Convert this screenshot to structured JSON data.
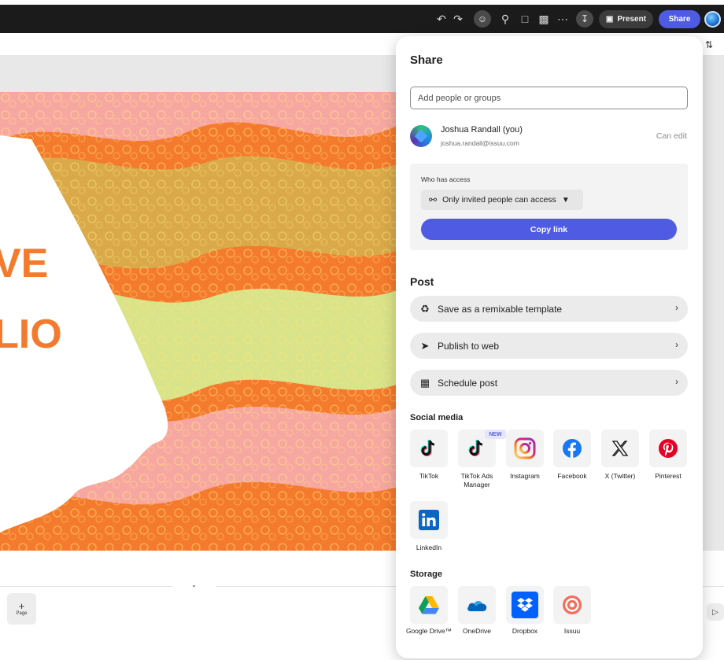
{
  "topbar": {
    "present_label": "Present",
    "share_label": "Share"
  },
  "canvas": {
    "text_line1": "VE",
    "text_line2": "LIO",
    "add_page_plus": "+",
    "add_page_label": "Page"
  },
  "share_panel": {
    "title": "Share",
    "add_people_placeholder": "Add people or groups",
    "user": {
      "name": "Joshua Randall (you)",
      "email": "joshua.randall@issuu.com",
      "permission": "Can edit"
    },
    "access": {
      "label": "Who has access",
      "selected": "Only invited people can access",
      "copy_link_label": "Copy link"
    },
    "post": {
      "title": "Post",
      "items": [
        {
          "label": "Save as a remixable template",
          "icon": "remix-icon"
        },
        {
          "label": "Publish to web",
          "icon": "send-icon"
        },
        {
          "label": "Schedule post",
          "icon": "calendar-icon"
        }
      ]
    },
    "social": {
      "title": "Social media",
      "new_badge": "NEW",
      "items": [
        {
          "label": "TikTok",
          "icon": "tiktok-icon"
        },
        {
          "label": "TikTok Ads Manager",
          "icon": "tiktok-icon"
        },
        {
          "label": "Instagram",
          "icon": "instagram-icon"
        },
        {
          "label": "Facebook",
          "icon": "facebook-icon"
        },
        {
          "label": "X (Twitter)",
          "icon": "x-icon"
        },
        {
          "label": "Pinterest",
          "icon": "pinterest-icon"
        },
        {
          "label": "LinkedIn",
          "icon": "linkedin-icon"
        }
      ]
    },
    "storage": {
      "title": "Storage",
      "items": [
        {
          "label": "Google Drive™",
          "icon": "google-drive-icon"
        },
        {
          "label": "OneDrive",
          "icon": "onedrive-icon"
        },
        {
          "label": "Dropbox",
          "icon": "dropbox-icon"
        },
        {
          "label": "Issuu",
          "icon": "issuu-icon"
        }
      ]
    }
  },
  "colors": {
    "accent": "#4f5be3",
    "topbar": "#1b1b1b",
    "orange": "#f47a2e",
    "pink": "#f7a7a2",
    "yellow_green": "#d8e38a"
  }
}
